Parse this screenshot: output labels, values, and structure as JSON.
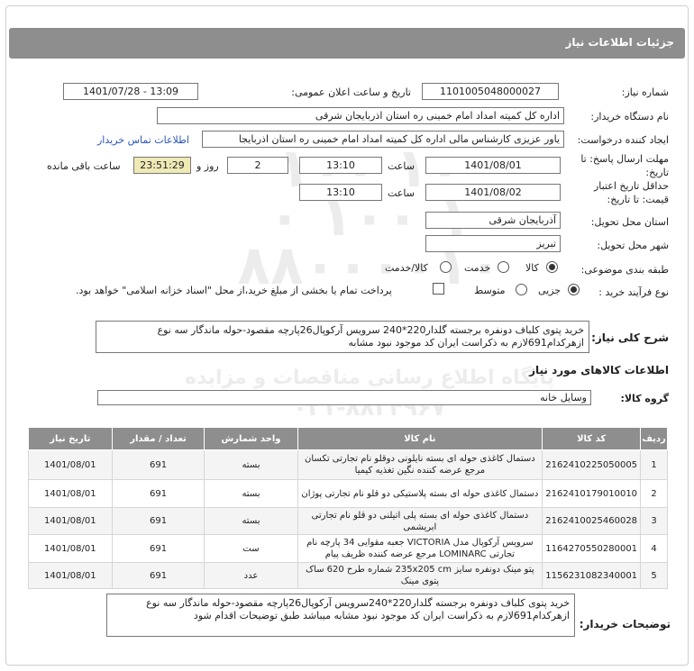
{
  "header": {
    "title": "جزئیات اطلاعات نیاز"
  },
  "watermark": {
    "lines": [
      "۱۰۰ ۱۰",
      "۰ ۱۰۰ ۱",
      "۸۸۰۰۰۰۱۰"
    ],
    "brand": "ParsNamadData",
    "tagline": "پایگاه اطلاع رسانی مناقصات و مزایده",
    "phone": "۰۲۱-۸۸۳۴۹۶۷"
  },
  "form": {
    "need_number": {
      "label": "شماره نیاز:",
      "value": "1101005048000027"
    },
    "announce_datetime": {
      "label": "تاریخ و ساعت اعلان عمومی:",
      "value": "1401/07/28 - 13:09"
    },
    "buyer_org": {
      "label": "نام دستگاه خریدار:",
      "value": "اداره کل کمیته امداد امام خمینی  ره  استان اذربایجان شرقی"
    },
    "requester": {
      "label": "ایجاد کننده درخواست:",
      "value": "یاور عزیزی کارشناس مالی اداره کل کمیته امداد امام خمینی  ره  استان اذربایجا",
      "contact_link": "اطلاعات تماس خریدار"
    },
    "response_deadline": {
      "label_line1": "مهلت ارسال پاسخ: تا",
      "label_line2": "تاریخ:",
      "date": "1401/08/01",
      "time_label": "ساعت",
      "time": "13:10",
      "days": "2",
      "days_label": "روز و",
      "remaining": "23:51:29",
      "remaining_label": "ساعت باقی مانده"
    },
    "price_validity": {
      "label_line1": "حداقل تاریخ اعتبار",
      "label_line2": "قیمت: تا تاریخ:",
      "date": "1401/08/02",
      "time_label": "ساعت",
      "time": "13:10"
    },
    "delivery_province": {
      "label": "استان محل تحویل:",
      "value": "آذربایجان شرقی"
    },
    "delivery_city": {
      "label": "شهر محل تحویل:",
      "value": "تبریز"
    },
    "category": {
      "label": "طبقه بندی موضوعی:",
      "options": [
        "کالا",
        "خدمت",
        "کالا/خدمت"
      ],
      "selected": "کالا"
    },
    "purchase_type": {
      "label": "نوع فرآیند خرید :",
      "options": [
        "جزیی",
        "متوسط"
      ],
      "selected": "جزیی",
      "checkbox_label": "پرداخت تمام یا بخشی از مبلغ خرید،از محل \"اسناد خزانه اسلامی\" خواهد بود."
    }
  },
  "summary": {
    "label": "شرح کلی نیاز:",
    "text": "خرید پتوی کلباف دونفره برجسته گلدار220*240 سرویس آرکوپال26پارچه مقصود-حوله ماندگار سه نوع ازهرکدام691لازم به ذکراست ایران کد موجود نبود مشابه"
  },
  "goods_section": {
    "title": "اطلاعات کالاهای مورد نیاز"
  },
  "goods_group": {
    "label": "گروه کالا:",
    "value": "وسایل خانه"
  },
  "table": {
    "headers": [
      "ردیف",
      "کد کالا",
      "نام کالا",
      "واحد شمارش",
      "تعداد / مقدار",
      "تاریخ نیاز"
    ],
    "rows": [
      {
        "row": "1",
        "code": "2162410225050005",
        "name": "دستمال کاغذی حوله ای بسته نایلونی دوقلو نام تجارتی تکسان مرجع عرضه کننده نگین تغذیه کیمیا",
        "unit": "بسته",
        "qty": "691",
        "date": "1401/08/01"
      },
      {
        "row": "2",
        "code": "2162410179010010",
        "name": "دستمال کاغذی حوله ای بسته پلاستیکی دو قلو نام تجارتی پوژان",
        "unit": "بسته",
        "qty": "691",
        "date": "1401/08/01"
      },
      {
        "row": "3",
        "code": "2162410025460028",
        "name": "دستمال کاغذی حوله ای بسته پلی اتیلنی دو قلو نام تجارتی ابریشمی",
        "unit": "بسته",
        "qty": "691",
        "date": "1401/08/01"
      },
      {
        "row": "4",
        "code": "1164270550280001",
        "name": "سرویس آرکوپال مدل VICTORIA جعبه مقوایی 34 پارچه نام تجارتی LOMINARC مرجع عرضه کننده ظریف پیام",
        "unit": "ست",
        "qty": "691",
        "date": "1401/08/01"
      },
      {
        "row": "5",
        "code": "1156231082340001",
        "name": "پتو مینک دونفره سایز 235x205 cm شماره طرح 620 ساک پتوی مینک",
        "unit": "عدد",
        "qty": "691",
        "date": "1401/08/01"
      }
    ]
  },
  "buyer_notes": {
    "label": "توضیحات خریدار:",
    "text": "خرید پتوی کلباف دونفره برجسته گلدار220*240سرویس آرکوپال26پارچه مقصود-حوله ماندگار سه نوع ازهرکدام691لازم به ذکراست ایران کد موجود نبود مشابه میباشد طبق توضیحات اقدام شود"
  }
}
